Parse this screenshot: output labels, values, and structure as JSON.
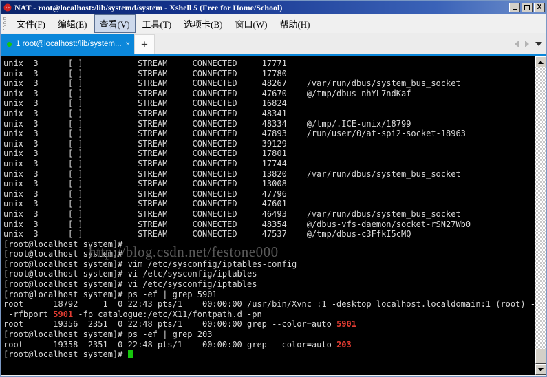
{
  "window": {
    "title": "NAT - root@localhost:/lib/systemd/system - Xshell 5 (Free for Home/School)",
    "minimize_label": "_",
    "maximize_label": "□",
    "close_label": "X"
  },
  "menubar": {
    "items": [
      {
        "label": "文件(F)"
      },
      {
        "label": "编辑(E)"
      },
      {
        "label": "查看(V)"
      },
      {
        "label": "工具(T)"
      },
      {
        "label": "选项卡(B)"
      },
      {
        "label": "窗口(W)"
      },
      {
        "label": "帮助(H)"
      }
    ],
    "active_index": 2
  },
  "tabbar": {
    "tab_number": "1",
    "tab_title": " root@localhost:/lib/system...",
    "close_label": "×",
    "new_tab_label": "+"
  },
  "watermark": "http://blog.csdn.net/festone000",
  "terminal": {
    "prompt": "[root@localhost system]# ",
    "lines": [
      {
        "text": "unix  3      [ ]           STREAM     CONNECTED     17771"
      },
      {
        "text": "unix  3      [ ]           STREAM     CONNECTED     17780"
      },
      {
        "text": "unix  3      [ ]           STREAM     CONNECTED     48267    /var/run/dbus/system_bus_socket"
      },
      {
        "text": "unix  3      [ ]           STREAM     CONNECTED     47670    @/tmp/dbus-nhYL7ndKaf"
      },
      {
        "text": "unix  3      [ ]           STREAM     CONNECTED     16824"
      },
      {
        "text": "unix  3      [ ]           STREAM     CONNECTED     48341"
      },
      {
        "text": "unix  3      [ ]           STREAM     CONNECTED     48334    @/tmp/.ICE-unix/18799"
      },
      {
        "text": "unix  3      [ ]           STREAM     CONNECTED     47893    /run/user/0/at-spi2-socket-18963"
      },
      {
        "text": "unix  3      [ ]           STREAM     CONNECTED     39129"
      },
      {
        "text": "unix  3      [ ]           STREAM     CONNECTED     17801"
      },
      {
        "text": "unix  3      [ ]           STREAM     CONNECTED     17744"
      },
      {
        "text": "unix  3      [ ]           STREAM     CONNECTED     13820    /var/run/dbus/system_bus_socket"
      },
      {
        "text": "unix  3      [ ]           STREAM     CONNECTED     13008"
      },
      {
        "text": "unix  3      [ ]           STREAM     CONNECTED     47796"
      },
      {
        "text": "unix  3      [ ]           STREAM     CONNECTED     47601"
      },
      {
        "text": "unix  3      [ ]           STREAM     CONNECTED     46493    /var/run/dbus/system_bus_socket"
      },
      {
        "text": "unix  3      [ ]           STREAM     CONNECTED     48354    @/dbus-vfs-daemon/socket-rSN27Wb0"
      },
      {
        "text": "unix  3      [ ]           STREAM     CONNECTED     47537    @/tmp/dbus-c3FfkI5cMQ"
      },
      {
        "text": "[root@localhost system]#"
      },
      {
        "text": "[root@localhost system]#"
      },
      {
        "text": "[root@localhost system]# vim /etc/sysconfig/iptables-config"
      },
      {
        "text": "[root@localhost system]# vi /etc/sysconfig/iptables"
      },
      {
        "text": "[root@localhost system]# vi /etc/sysconfig/iptables"
      },
      {
        "text": "[root@localhost system]# ps -ef | grep 5901"
      },
      {
        "text": "root      18792     1  0 22:43 pts/1    00:00:00 /usr/bin/Xvnc :1 -desktop localhost.localdomain:1 (root) -au"
      },
      {
        "segments": [
          {
            "text": " -rfbport "
          },
          {
            "text": "5901",
            "style": "red"
          },
          {
            "text": " -fp catalogue:/etc/X11/fontpath.d -pn"
          }
        ]
      },
      {
        "segments": [
          {
            "text": "root      19356  2351  0 22:48 pts/1    00:00:00 grep --color=auto "
          },
          {
            "text": "5901",
            "style": "red"
          }
        ]
      },
      {
        "text": "[root@localhost system]# ps -ef | grep 203"
      },
      {
        "segments": [
          {
            "text": "root      19358  2351  0 22:48 pts/1    00:00:00 grep --color=auto "
          },
          {
            "text": "203",
            "style": "red"
          }
        ]
      },
      {
        "segments": [
          {
            "text": "[root@localhost system]# "
          },
          {
            "text": "",
            "style": "cursor"
          }
        ]
      }
    ]
  },
  "colors": {
    "tab_active": "#0b87da",
    "terminal_bg": "#000000",
    "terminal_fg": "#d8d8d8",
    "highlight_red": "#e23c32",
    "cursor_green": "#16c60c"
  }
}
